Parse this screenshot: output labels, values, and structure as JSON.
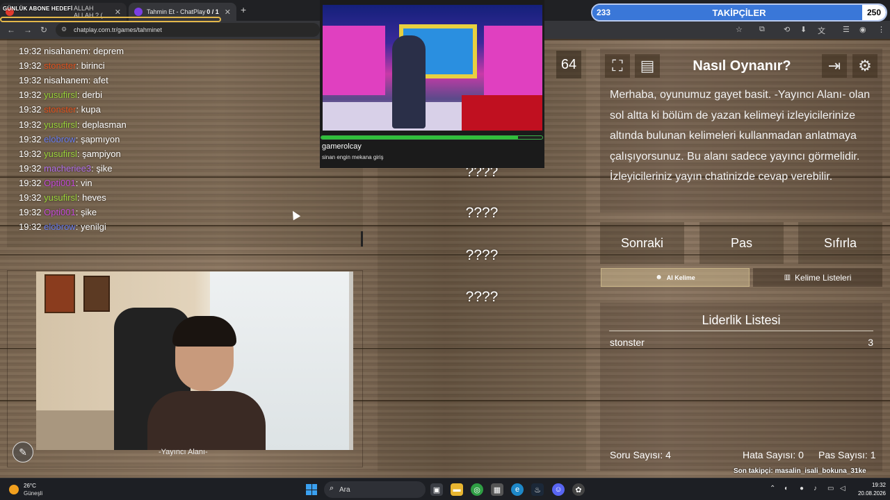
{
  "browser": {
    "tabs": [
      {
        "label": "ALLAH ALLAH ? (",
        "counter": "",
        "favicon_color": "#e33b2e"
      },
      {
        "label": "Tahmin Et - ChatPlay",
        "counter": "0 / 1",
        "favicon_color": "#7b3fe4"
      }
    ],
    "url": "chatplay.com.tr/games/tahminet"
  },
  "overlay": {
    "goal_label": "GÜNLÜK ABONE HEDEFİ",
    "followers": {
      "label": "TAKİPÇİLER",
      "current": "233",
      "target": "250",
      "progress": 0.932
    }
  },
  "chat": [
    {
      "time": "19:32",
      "user": "nisahanem",
      "color": "#ffffff",
      "msg": "deprem"
    },
    {
      "time": "19:32",
      "user": "stonster",
      "color": "#e0521e",
      "msg": "birinci"
    },
    {
      "time": "19:32",
      "user": "nisahanem",
      "color": "#ffffff",
      "msg": "afet"
    },
    {
      "time": "19:32",
      "user": "yusufirsl",
      "color": "#9ad43a",
      "msg": "derbi"
    },
    {
      "time": "19:32",
      "user": "stonster",
      "color": "#e0521e",
      "msg": "kupa"
    },
    {
      "time": "19:32",
      "user": "yusufirsl",
      "color": "#9ad43a",
      "msg": "deplasman"
    },
    {
      "time": "19:32",
      "user": "elobrow",
      "color": "#6a7ef0",
      "msg": "şapmıyon"
    },
    {
      "time": "19:32",
      "user": "yusufirsl",
      "color": "#9ad43a",
      "msg": "şampiyon"
    },
    {
      "time": "19:32",
      "user": "macheriee3",
      "color": "#b06ee8",
      "msg": "şike"
    },
    {
      "time": "19:32",
      "user": "Opti001",
      "color": "#c44ad8",
      "msg": "vin"
    },
    {
      "time": "19:32",
      "user": "yusufirsl",
      "color": "#9ad43a",
      "msg": "heves"
    },
    {
      "time": "19:32",
      "user": "Opti001",
      "color": "#c44ad8",
      "msg": "şike"
    },
    {
      "time": "19:32",
      "user": "elobrow",
      "color": "#6a7ef0",
      "msg": "yenilgi"
    }
  ],
  "webcam": {
    "label": "-Yayıncı Alanı-"
  },
  "video": {
    "user": "gamerolcay",
    "title": "sinan engin mekana giriş",
    "progress": 0.89
  },
  "game": {
    "counter": "64",
    "hidden_words": [
      "????",
      "????",
      "????",
      "????"
    ]
  },
  "howto": {
    "title": "Nasıl Oynanır?",
    "text": "Merhaba, oyunumuz gayet basit. -Yayıncı Alanı- olan sol altta ki bölüm de yazan kelimeyi izleyicilerinize altında bulunan kelimeleri kullanmadan anlatmaya çalışıyorsunuz. Bu alanı sadece yayıncı görmelidir. İzleyicileriniz yayın chatinizde cevap verebilir."
  },
  "buttons": {
    "next": "Sonraki",
    "pass": "Pas",
    "reset": "Sıfırla",
    "ai_word": "AI Kelime",
    "word_lists": "Kelime Listeleri"
  },
  "leaderboard": {
    "title": "Liderlik Listesi",
    "entries": [
      {
        "name": "stonster",
        "score": "3"
      }
    ]
  },
  "stats": {
    "questions": "Soru Sayısı: 4",
    "errors": "Hata Sayısı: 0",
    "passes": "Pas Sayısı: 1"
  },
  "last_follower": "Son takipçi: masalin_isali_bokuna_31ke",
  "taskbar": {
    "weather_temp": "26°C",
    "weather_desc": "Güneşli",
    "search_placeholder": "Ara",
    "time": "19:32",
    "date": "20.08.2026"
  }
}
